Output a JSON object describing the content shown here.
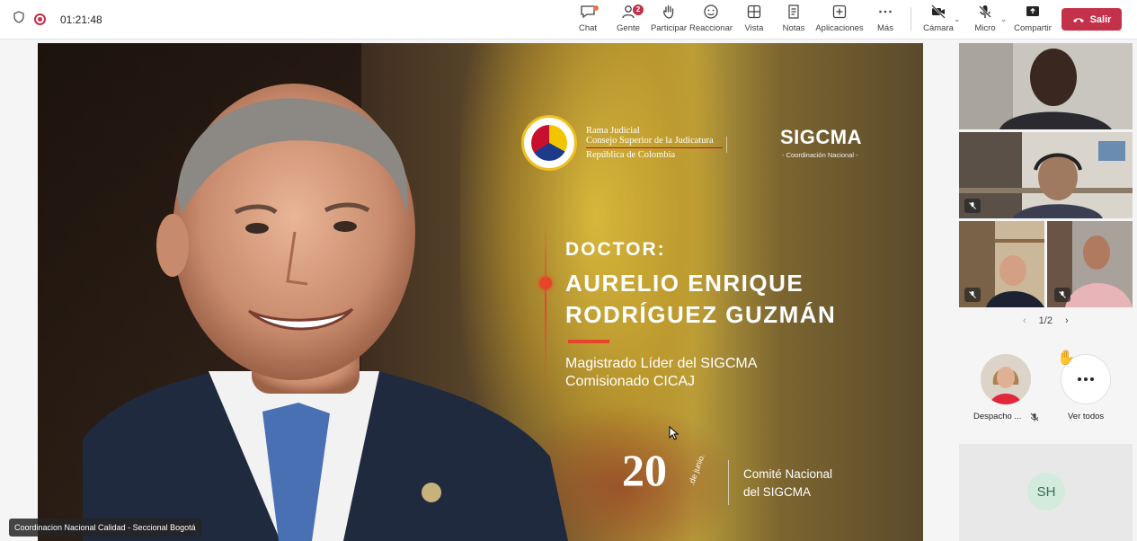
{
  "topbar": {
    "timer": "01:21:48",
    "actions": [
      {
        "label": "Chat",
        "icon": "chat-icon"
      },
      {
        "label": "Gente",
        "icon": "people-icon",
        "badge": "2"
      },
      {
        "label": "Participar",
        "icon": "raise-hand-icon"
      },
      {
        "label": "Reaccionar",
        "icon": "smiley-icon"
      },
      {
        "label": "Vista",
        "icon": "grid-icon"
      },
      {
        "label": "Notas",
        "icon": "notes-icon"
      },
      {
        "label": "Aplicaciones",
        "icon": "plus-square-icon"
      },
      {
        "label": "Más",
        "icon": "more-icon"
      },
      {
        "label": "Cámara",
        "icon": "camera-off-icon"
      },
      {
        "label": "Micro",
        "icon": "mic-off-icon"
      },
      {
        "label": "Compartir",
        "icon": "share-icon"
      }
    ],
    "leave_label": "Salir",
    "accent": "#c4314b"
  },
  "stage": {
    "presenter_tag": "Coordinacion Nacional Calidad - Seccional Bogotá",
    "slide": {
      "org_line1": "Rama Judicial",
      "org_line2": "Consejo Superior de la Judicatura",
      "org_line3": "República de Colombia",
      "brand": "SIGCMA",
      "brand_sub": "- Coordinación Nacional -",
      "doctor": "DOCTOR:",
      "name_line1": "AURELIO ENRIQUE",
      "name_line2": "RODRÍGUEZ GUZMÁN",
      "role1": "Magistrado Líder del SIGCMA",
      "role2": "Comisionado CICAJ",
      "date_num": "20",
      "date_month": ".de junio.",
      "event1": "Comité Nacional",
      "event2": "del SIGCMA",
      "accent": "#e6452b"
    }
  },
  "sidebar": {
    "pager": "1/2",
    "participant_name": "Despacho ...",
    "see_all": "Ver todos",
    "sh_initials": "SH"
  }
}
